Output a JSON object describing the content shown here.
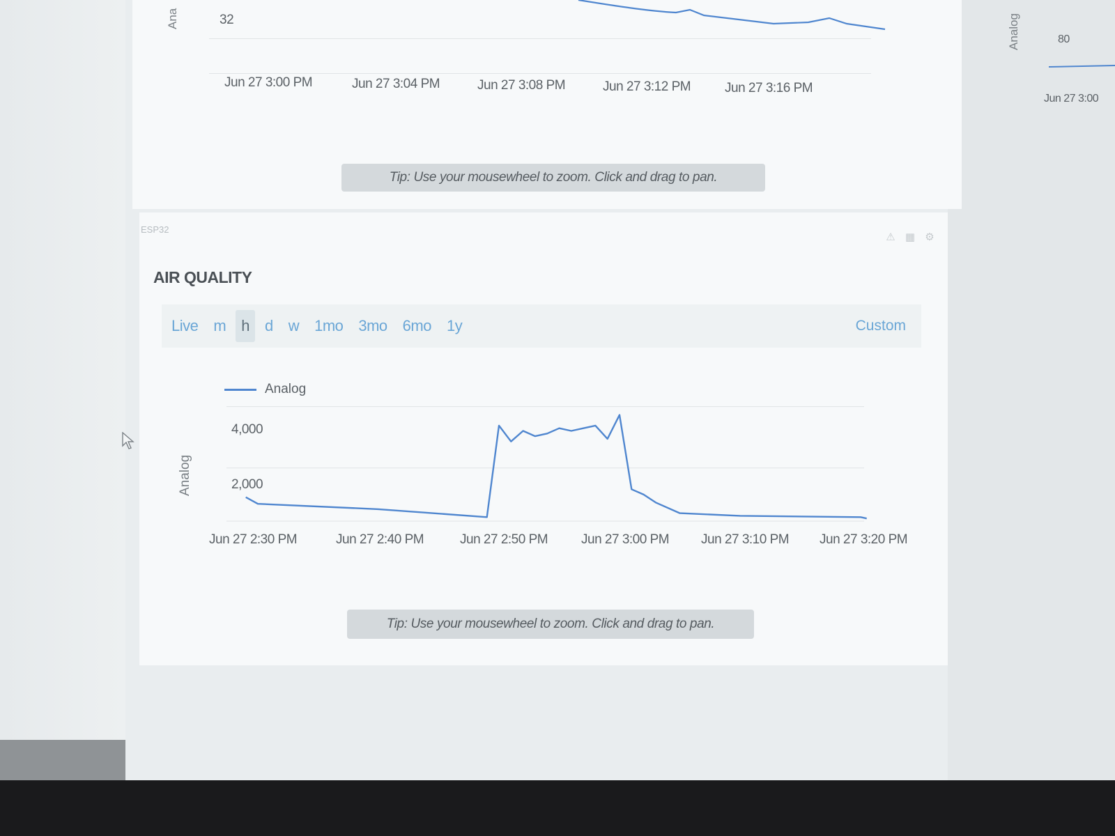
{
  "top_widget": {
    "y_axis_label": "Ana",
    "y_tick": "32",
    "x_ticks": [
      "Jun 27 3:00 PM",
      "Jun 27 3:04 PM",
      "Jun 27 3:08 PM",
      "Jun 27 3:12 PM",
      "Jun 27 3:16 PM"
    ],
    "tip": "Tip: Use your mousewheel to zoom. Click and drag to pan."
  },
  "right_widget": {
    "y_axis_label": "Analog",
    "y_tick": "80",
    "x_tick": "Jun 27 3:00"
  },
  "air_widget": {
    "device": "ESP32",
    "title": "AIR QUALITY",
    "ranges": [
      {
        "label": "Live",
        "active": false
      },
      {
        "label": "m",
        "active": false
      },
      {
        "label": "h",
        "active": true
      },
      {
        "label": "d",
        "active": false
      },
      {
        "label": "w",
        "active": false
      },
      {
        "label": "1mo",
        "active": false
      },
      {
        "label": "3mo",
        "active": false
      },
      {
        "label": "6mo",
        "active": false
      },
      {
        "label": "1y",
        "active": false
      }
    ],
    "custom": "Custom",
    "tip": "Tip: Use your mousewheel to zoom. Click and drag to pan.",
    "icons": [
      "warning-icon",
      "chart-icon",
      "gear-icon"
    ]
  },
  "colors": {
    "series": "#4f86cf",
    "accent": "#6aa6d6"
  },
  "chart_data": [
    {
      "type": "line",
      "ylabel": "Analog",
      "series": [
        {
          "name": "Analog",
          "x": [
            "2:29",
            "2:30",
            "2:40",
            "2:49",
            "2:50",
            "2:51",
            "2:52",
            "2:53",
            "2:54",
            "2:55",
            "2:56",
            "2:57",
            "2:58",
            "2:59",
            "3:00",
            "3:01",
            "3:02",
            "3:03",
            "3:05",
            "3:10",
            "3:20",
            "3:20:30"
          ],
          "y": [
            900,
            650,
            450,
            150,
            3600,
            3000,
            3400,
            3200,
            3300,
            3500,
            3400,
            3500,
            3600,
            3100,
            4000,
            1200,
            1000,
            700,
            300,
            200,
            150,
            100
          ]
        }
      ],
      "x_ticks": [
        "Jun 27 2:30 PM",
        "Jun 27 2:40 PM",
        "Jun 27 2:50 PM",
        "Jun 27 3:00 PM",
        "Jun 27 3:10 PM",
        "Jun 27 3:20 PM"
      ],
      "y_ticks": [
        "4,000",
        "2,000"
      ],
      "ylim": [
        0,
        4200
      ],
      "grid": true,
      "legend": "top-left"
    }
  ]
}
